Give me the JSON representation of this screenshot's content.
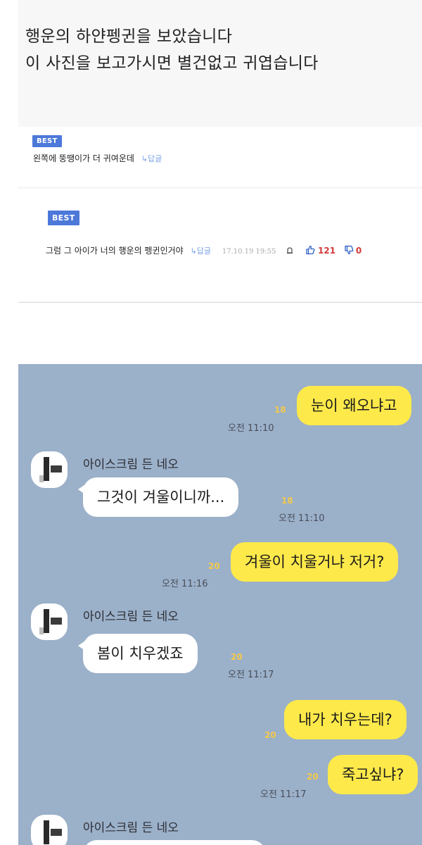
{
  "post": {
    "line1": "행운의 하얀펭귄을 보았습니다",
    "line2": "이 사진을 보고가시면 별건없고 귀엽습니다"
  },
  "comments": [
    {
      "badge": "BEST",
      "text": "왼쪽에 뚱땡이가 더 귀여운데",
      "reply_label": "답글"
    },
    {
      "badge": "BEST",
      "text": "그럼 그 아이가 너의 행운의 펭귄인거야",
      "reply_label": "답글",
      "date": "17.10.19 19:55",
      "upvotes": "121",
      "downvotes": "0"
    }
  ],
  "chat": {
    "sender_name": "아이스크림 든 네오",
    "messages": [
      {
        "side": "mine",
        "text": "눈이 왜오냐고",
        "unread": "18",
        "time": "오전 11:10"
      },
      {
        "side": "theirs",
        "text": "그것이 겨울이니까...",
        "unread": "18",
        "time": "오전 11:10"
      },
      {
        "side": "mine",
        "text": "겨울이 치울거냐 저거?",
        "unread": "20",
        "time": "오전 11:16"
      },
      {
        "side": "theirs",
        "text": "봄이 치우겠죠",
        "unread": "20",
        "time": "오전 11:17"
      },
      {
        "side": "mine",
        "text": "내가 치우는데?",
        "unread": "20",
        "time": ""
      },
      {
        "side": "mine",
        "text": "죽고싶냐?",
        "unread": "20",
        "time": "오전 11:17"
      }
    ]
  },
  "colors": {
    "chat_background": "#9bb0c9",
    "my_bubble": "#fde94a",
    "their_bubble": "#ffffff",
    "best_badge": "#4c78d9",
    "vote": "#d43a3a"
  },
  "icons": [
    "reply-arrow-icon",
    "report-bell-icon",
    "thumbs-up-icon",
    "thumbs-down-icon",
    "profile-avatar-icon"
  ]
}
